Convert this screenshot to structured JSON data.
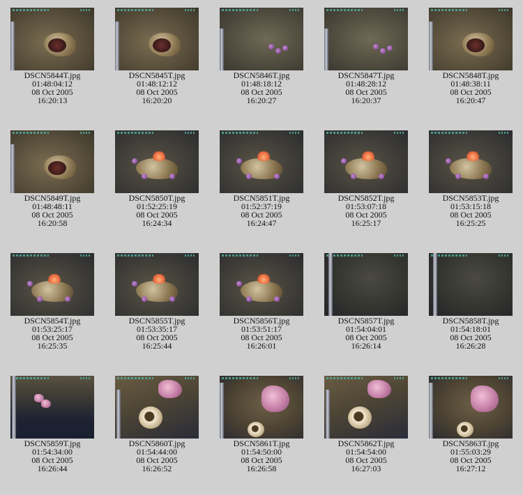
{
  "gallery": {
    "items": [
      {
        "filename": "DSCN5844T.jpg",
        "timecode": "01:48:04:12",
        "date": "08 Oct 2005",
        "time": "16:20:13",
        "scene": "rock"
      },
      {
        "filename": "DSCN5845T.jpg",
        "timecode": "01:48:12:12",
        "date": "08 Oct 2005",
        "time": "16:20:20",
        "scene": "rock"
      },
      {
        "filename": "DSCN5846T.jpg",
        "timecode": "01:48:18:12",
        "date": "08 Oct 2005",
        "time": "16:20:27",
        "scene": "urchin"
      },
      {
        "filename": "DSCN5847T.jpg",
        "timecode": "01:48:28:12",
        "date": "08 Oct 2005",
        "time": "16:20:37",
        "scene": "urchin"
      },
      {
        "filename": "DSCN5848T.jpg",
        "timecode": "01:48:38:11",
        "date": "08 Oct 2005",
        "time": "16:20:47",
        "scene": "rock"
      },
      {
        "filename": "DSCN5849T.jpg",
        "timecode": "01:48:48:11",
        "date": "08 Oct 2005",
        "time": "16:20:58",
        "scene": "rock"
      },
      {
        "filename": "DSCN5850T.jpg",
        "timecode": "01:52:25:19",
        "date": "08 Oct 2005",
        "time": "16:24:34",
        "scene": "anemone"
      },
      {
        "filename": "DSCN5851T.jpg",
        "timecode": "01:52:37:19",
        "date": "08 Oct 2005",
        "time": "16:24:47",
        "scene": "anemone"
      },
      {
        "filename": "DSCN5852T.jpg",
        "timecode": "01:53:07:18",
        "date": "08 Oct 2005",
        "time": "16:25:17",
        "scene": "anemone"
      },
      {
        "filename": "DSCN5853T.jpg",
        "timecode": "01:53:15:18",
        "date": "08 Oct 2005",
        "time": "16:25:25",
        "scene": "anemone"
      },
      {
        "filename": "DSCN5854T.jpg",
        "timecode": "01:53:25:17",
        "date": "08 Oct 2005",
        "time": "16:25:35",
        "scene": "anemone"
      },
      {
        "filename": "DSCN5855T.jpg",
        "timecode": "01:53:35:17",
        "date": "08 Oct 2005",
        "time": "16:25:44",
        "scene": "anemone"
      },
      {
        "filename": "DSCN5856T.jpg",
        "timecode": "01:53:51:17",
        "date": "08 Oct 2005",
        "time": "16:26:01",
        "scene": "anemone"
      },
      {
        "filename": "DSCN5857T.jpg",
        "timecode": "01:54:04:01",
        "date": "08 Oct 2005",
        "time": "16:26:14",
        "scene": "dark"
      },
      {
        "filename": "DSCN5858T.jpg",
        "timecode": "01:54:18:01",
        "date": "08 Oct 2005",
        "time": "16:26:28",
        "scene": "dark"
      },
      {
        "filename": "DSCN5859T.jpg",
        "timecode": "01:54:34:00",
        "date": "08 Oct 2005",
        "time": "16:26:44",
        "scene": "wall"
      },
      {
        "filename": "DSCN5860T.jpg",
        "timecode": "01:54:44:00",
        "date": "08 Oct 2005",
        "time": "16:26:52",
        "scene": "sponge"
      },
      {
        "filename": "DSCN5861T.jpg",
        "timecode": "01:54:50:00",
        "date": "08 Oct 2005",
        "time": "16:26:58",
        "scene": "coral"
      },
      {
        "filename": "DSCN5862T.jpg",
        "timecode": "01:54:54:00",
        "date": "08 Oct 2005",
        "time": "16:27:03",
        "scene": "sponge"
      },
      {
        "filename": "DSCN5863T.jpg",
        "timecode": "01:55:03:29",
        "date": "08 Oct 2005",
        "time": "16:27:12",
        "scene": "coral"
      }
    ]
  }
}
